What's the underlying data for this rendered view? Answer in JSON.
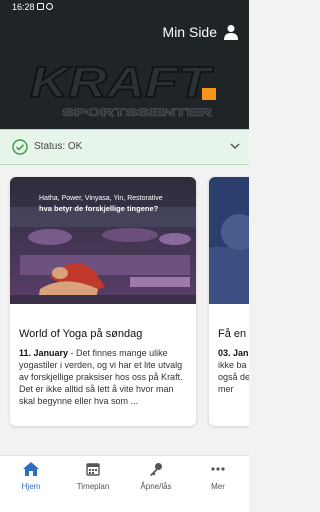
{
  "status_bar": {
    "time": "16:28"
  },
  "header": {
    "account_label": "Min Side",
    "logo_text": "KRAFT",
    "logo_subtext": "SPORTSSENTER"
  },
  "status": {
    "text": "Status: OK"
  },
  "cards": [
    {
      "image_caption": "Hatha, Power, Vinyasa, Yin, Restorative",
      "image_headline": "hva betyr de forskjellige tingene?",
      "title": "World of Yoga på søndag",
      "date": "11. January",
      "excerpt": " - Det finnes mange ulike yogastiler i verden, og vi har et lite utvalg av forskjellige praksiser hos oss på Kraft. Det er ikke alltid så lett å vite hvor man skal begynne eller hva som ..."
    },
    {
      "title": "Få en",
      "date": "03. Jan",
      "excerpt_lines": [
        "ikke ba",
        "også de",
        "mer"
      ]
    }
  ],
  "nav": [
    {
      "label": "Hjem",
      "icon": "home-icon"
    },
    {
      "label": "Timeplan",
      "icon": "calendar-icon"
    },
    {
      "label": "Åpne/lås",
      "icon": "key-icon"
    },
    {
      "label": "Mer",
      "icon": "more-icon"
    }
  ],
  "colors": {
    "header_bg": "#1f2426",
    "logo_accent": "#f7941d",
    "status_ok": "#3a9a4a",
    "nav_active": "#2f6fc0"
  }
}
